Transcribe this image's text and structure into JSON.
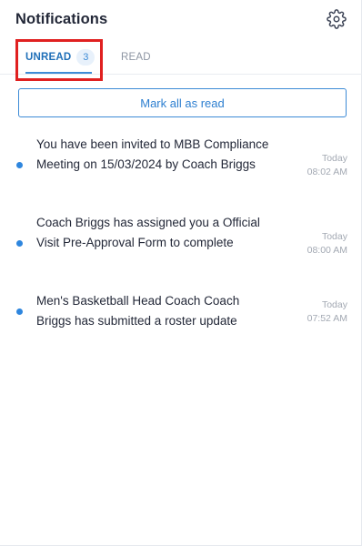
{
  "header": {
    "title": "Notifications",
    "settings_icon": "gear-icon"
  },
  "tabs": [
    {
      "label": "UNREAD",
      "count": "3",
      "active": true
    },
    {
      "label": "READ",
      "active": false
    }
  ],
  "actions": {
    "mark_all_label": "Mark all as read"
  },
  "notifications": [
    {
      "text": "You have been invited to MBB Compliance Meeting on 15/03/2024 by Coach Briggs",
      "date": "Today",
      "time": "08:02 AM",
      "unread": true
    },
    {
      "text": "Coach Briggs has assigned you a Official Visit Pre-Approval Form to complete",
      "date": "Today",
      "time": "08:00 AM",
      "unread": true
    },
    {
      "text": "Men's Basketball Head Coach Coach Briggs has submitted a roster update",
      "date": "Today",
      "time": "07:52 AM",
      "unread": true
    }
  ],
  "colors": {
    "accent": "#2E86DE",
    "highlight": "#E02020"
  }
}
